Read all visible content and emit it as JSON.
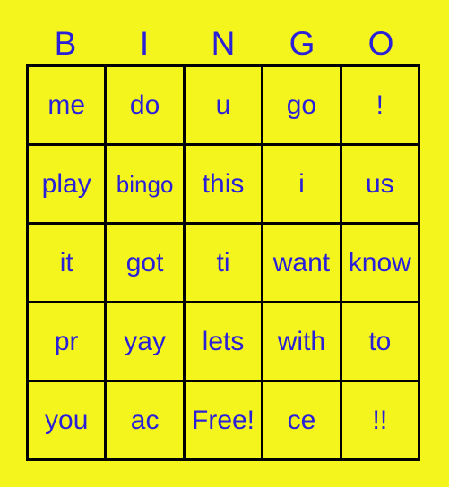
{
  "card": {
    "background_color": "#f5f51e",
    "text_color": "#2a20d8",
    "border_color": "#000000",
    "header": {
      "letters": [
        "B",
        "I",
        "N",
        "G",
        "O"
      ]
    },
    "free_space_label": "Free!",
    "rows": [
      {
        "cells": [
          {
            "label": "me",
            "tight": false
          },
          {
            "label": "do",
            "tight": false
          },
          {
            "label": "u",
            "tight": false
          },
          {
            "label": "go",
            "tight": false
          },
          {
            "label": "!",
            "tight": false
          }
        ]
      },
      {
        "cells": [
          {
            "label": "play",
            "tight": false
          },
          {
            "label": "bingo",
            "tight": true
          },
          {
            "label": "this",
            "tight": false
          },
          {
            "label": "i",
            "tight": false
          },
          {
            "label": "us",
            "tight": false
          }
        ]
      },
      {
        "cells": [
          {
            "label": "it",
            "tight": false
          },
          {
            "label": "got",
            "tight": false
          },
          {
            "label": "ti",
            "tight": false
          },
          {
            "label": "want",
            "tight": false
          },
          {
            "label": "know",
            "tight": false
          }
        ]
      },
      {
        "cells": [
          {
            "label": "pr",
            "tight": false
          },
          {
            "label": "yay",
            "tight": false
          },
          {
            "label": "lets",
            "tight": false
          },
          {
            "label": "with",
            "tight": false
          },
          {
            "label": "to",
            "tight": false
          }
        ]
      },
      {
        "cells": [
          {
            "label": "you",
            "tight": false
          },
          {
            "label": "ac",
            "tight": false
          },
          {
            "label": "Free!",
            "tight": false
          },
          {
            "label": "ce",
            "tight": false
          },
          {
            "label": "!!",
            "tight": false
          }
        ]
      }
    ]
  }
}
